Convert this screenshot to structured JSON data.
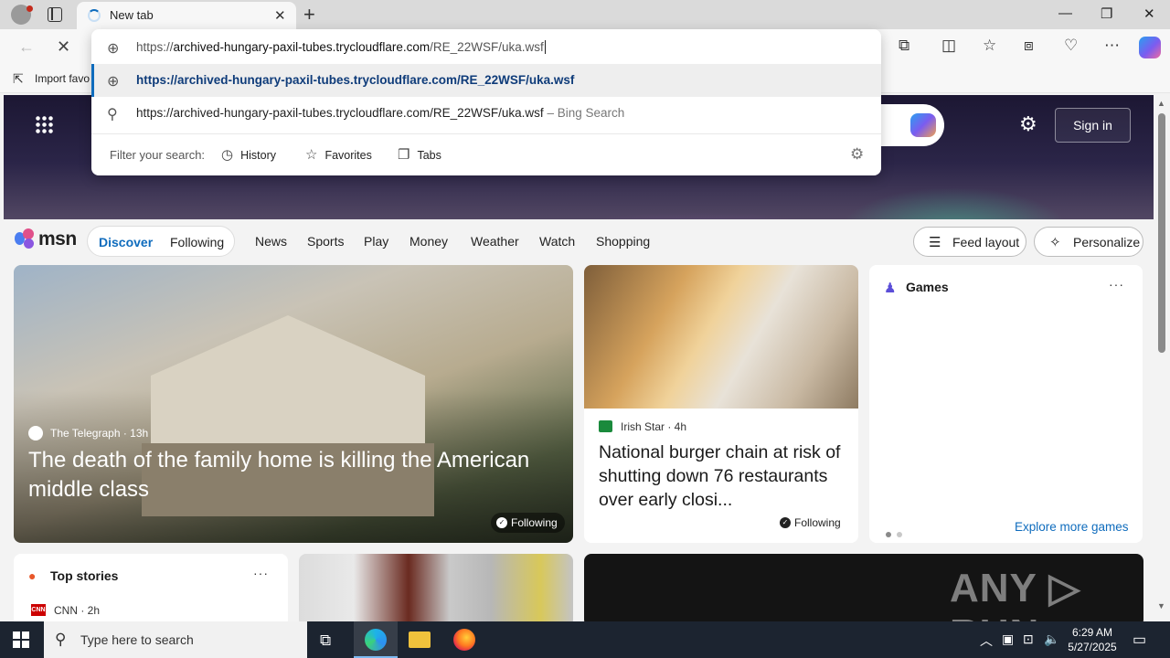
{
  "browser": {
    "tab_title": "New tab",
    "new_tab_symbol": "+",
    "favorites_bar_item": "Import favo",
    "address": {
      "typed_prefix": "https://",
      "typed_host": "archived-hungary-paxil-tubes.trycloudflare.com",
      "typed_path": "/RE_22WSF/uka.wsf",
      "suggestion_url": "https://archived-hungary-paxil-tubes.trycloudflare.com/RE_22WSF/uka.wsf",
      "search_query": "https://archived-hungary-paxil-tubes.trycloudflare.com/RE_22WSF/uka.wsf",
      "search_suffix": " – Bing Search",
      "filter_label": "Filter your search:",
      "filters": [
        "History",
        "Favorites",
        "Tabs"
      ]
    }
  },
  "msn": {
    "logo_text": "msn",
    "sign_in": "Sign in",
    "pills": {
      "active": "Discover",
      "other": "Following"
    },
    "nav_links": [
      "News",
      "Sports",
      "Play",
      "Money",
      "Weather",
      "Watch",
      "Shopping"
    ],
    "feed_layout": "Feed layout",
    "personalize": "Personalize",
    "main_card": {
      "source": "The Telegraph · 13h",
      "headline": "The death of the family home is killing the American middle class",
      "follow": "Following"
    },
    "burger_card": {
      "source": "Irish Star · 4h",
      "headline": "National burger chain at risk of shutting down 76 restaurants over early closi...",
      "follow": "Following"
    },
    "games_card": {
      "title": "Games",
      "more": "···",
      "link": "Explore more games"
    },
    "top_stories": {
      "title": "Top stories",
      "more": "···",
      "source": "CNN · 2h",
      "cnn": "CNN"
    },
    "watermark": "ANY ▷ RUN"
  },
  "taskbar": {
    "search_placeholder": "Type here to search",
    "time": "6:29 AM",
    "date": "5/27/2025"
  },
  "colors": {
    "accent": "#0f6cbd",
    "taskbar": "#1c2430"
  }
}
